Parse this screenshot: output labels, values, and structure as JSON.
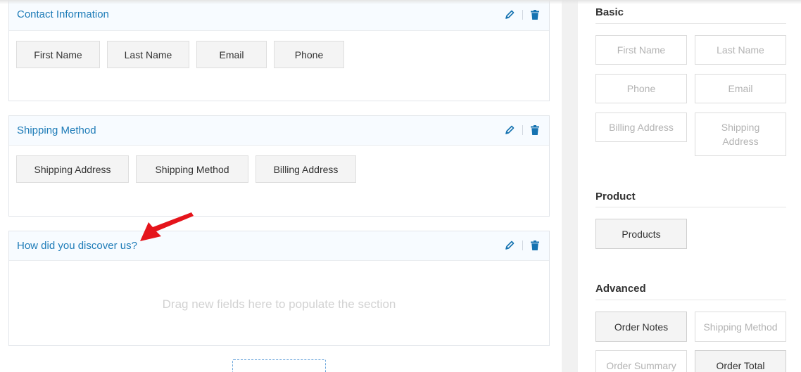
{
  "sections": [
    {
      "title": "Contact Information",
      "fields": [
        "First Name",
        "Last Name",
        "Email",
        "Phone"
      ]
    },
    {
      "title": "Shipping Method",
      "fields": [
        "Shipping Address",
        "Shipping Method",
        "Billing Address"
      ]
    },
    {
      "title": "How did you discover us?",
      "placeholder": "Drag new fields here to populate the section"
    }
  ],
  "sidebar": {
    "basic": {
      "title": "Basic",
      "items": [
        "First Name",
        "Last Name",
        "Phone",
        "Email",
        "Billing Address",
        "Shipping Address"
      ]
    },
    "product": {
      "title": "Product",
      "items": [
        "Products"
      ]
    },
    "advanced": {
      "title": "Advanced",
      "items": [
        "Order Notes",
        "Shipping Method",
        "Order Summary",
        "Order Total"
      ]
    }
  },
  "icons": {
    "edit": "pencil-icon",
    "delete": "trash-icon"
  },
  "colors": {
    "accent": "#1e7cb8",
    "annotation": "#e5141b",
    "icon": "#1673b1"
  }
}
